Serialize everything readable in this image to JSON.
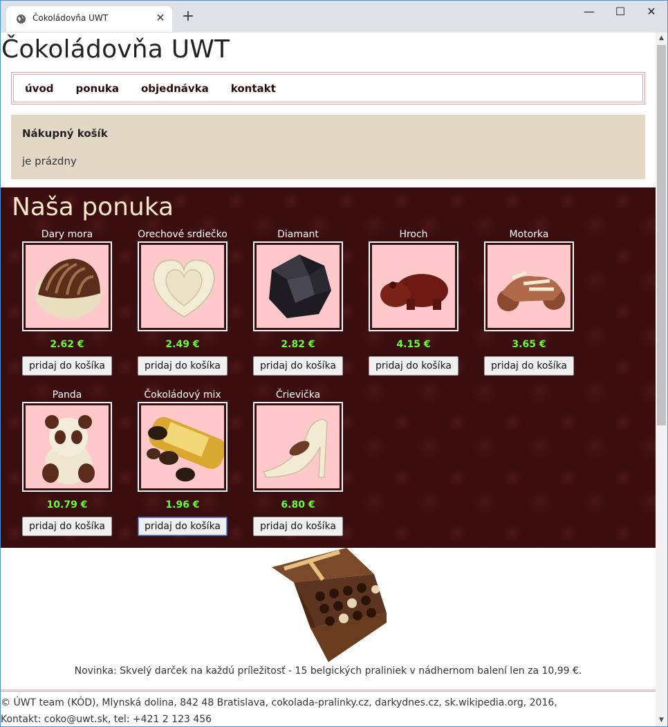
{
  "browser": {
    "tab_title": "Čokoládovňa UWT",
    "close_tab": "✕",
    "new_tab": "+",
    "minimize": "—",
    "maximize": "☐",
    "close_window": "✕"
  },
  "site": {
    "title": "Čokoládovňa UWT"
  },
  "nav": {
    "items": [
      {
        "label": "úvod"
      },
      {
        "label": "ponuka"
      },
      {
        "label": "objednávka"
      },
      {
        "label": "kontakt"
      }
    ]
  },
  "cart": {
    "title": "Nákupný košík",
    "status": "je prázdny"
  },
  "offer": {
    "title": "Naša ponuka",
    "button_label": "pridaj do košíka",
    "products": [
      {
        "name": "Dary mora",
        "price": "2.62 €",
        "icon": "seashell-chocolate-icon"
      },
      {
        "name": "Orechové srdiečko",
        "price": "2.49 €",
        "icon": "heart-chocolate-icon"
      },
      {
        "name": "Diamant",
        "price": "2.82 €",
        "icon": "diamond-chocolate-icon"
      },
      {
        "name": "Hroch",
        "price": "4.15 €",
        "icon": "hippo-chocolate-icon"
      },
      {
        "name": "Motorka",
        "price": "3.65 €",
        "icon": "motorbike-chocolate-icon"
      },
      {
        "name": "Panda",
        "price": "10.79 €",
        "icon": "panda-chocolate-icon"
      },
      {
        "name": "Čokoládový mix",
        "price": "1.96 €",
        "icon": "chocolate-mix-icon"
      },
      {
        "name": "Črievička",
        "price": "6.80 €",
        "icon": "shoe-chocolate-icon"
      }
    ]
  },
  "promo": {
    "text": "Novinka: Skvelý darček na každú príležitosť - 15 belgických praliniek v nádhernom balení len za 10,99 €."
  },
  "footer": {
    "line1": "© ÚWT team (KÓD), Mlynská dolina, 842 48 Bratislava, cokolada-pralinky.cz, darkydnes.cz, sk.wikipedia.org, 2016,",
    "line2": "Kontakt: coko@uwt.sk, tel: +421 2 123 456"
  },
  "colors": {
    "offer_bg": "#3a0d0e",
    "price": "#66ff33",
    "cart_bg": "#e3d8c5",
    "nav_border": "#e3a0a0",
    "product_bg": "#ffc9cb"
  }
}
